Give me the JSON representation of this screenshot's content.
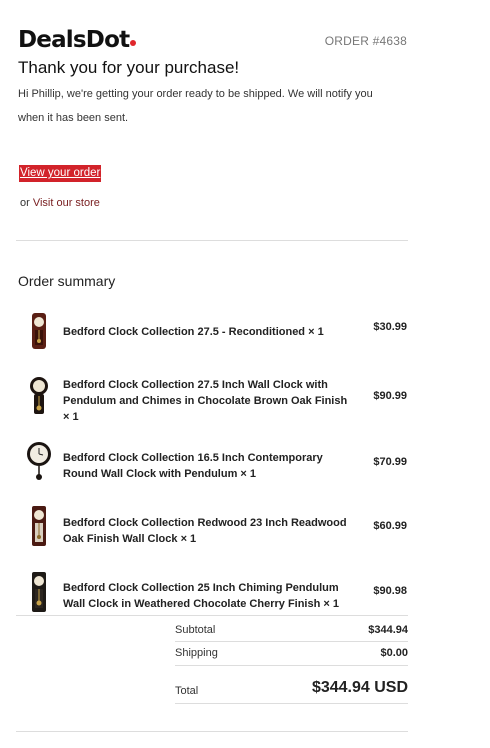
{
  "brand": {
    "name": "DealsDot",
    "accent": "#e0262b"
  },
  "order_number": "ORDER #4638",
  "title": "Thank you for your purchase!",
  "intro": "Hi Phillip, we're getting your order ready to be shipped. We will notify you when it has been sent.",
  "actions": {
    "view_order": "View your order",
    "or": "or",
    "visit_store": "Visit our store"
  },
  "summary": {
    "heading": "Order summary",
    "items": [
      {
        "name": "Bedford Clock Collection 27.5 - Reconditioned × 1",
        "price": "$30.99",
        "icon": "pendulum-clock-icon"
      },
      {
        "name": "Bedford Clock Collection 27.5 Inch Wall Clock with Pendulum and Chimes in Chocolate Brown Oak Finish × 1",
        "price": "$90.99",
        "icon": "pendulum-clock-icon"
      },
      {
        "name": "Bedford Clock Collection 16.5 Inch Contemporary Round Wall Clock with Pendulum × 1",
        "price": "$70.99",
        "icon": "round-clock-icon"
      },
      {
        "name": "Bedford Clock Collection Redwood 23 Inch Readwood Oak Finish Wall Clock × 1",
        "price": "$60.99",
        "icon": "pendulum-clock-icon"
      },
      {
        "name": "Bedford Clock Collection 25 Inch Chiming Pendulum Wall Clock in Weathered Chocolate Cherry Finish × 1",
        "price": "$90.98",
        "icon": "pendulum-clock-icon"
      }
    ]
  },
  "totals": {
    "subtotal_label": "Subtotal",
    "subtotal": "$344.94",
    "shipping_label": "Shipping",
    "shipping": "$0.00",
    "total_label": "Total",
    "total": "$344.94 USD"
  }
}
